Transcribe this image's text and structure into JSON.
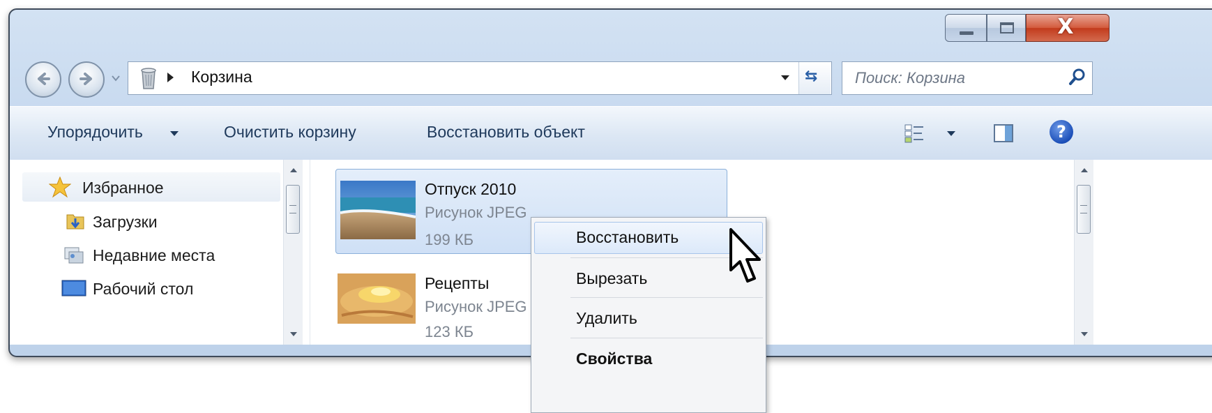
{
  "window": {
    "controls": {
      "close_glyph": "X"
    }
  },
  "address_bar": {
    "location": "Корзина"
  },
  "search": {
    "placeholder": "Поиск: Корзина"
  },
  "toolbar": {
    "organize": "Упорядочить",
    "empty_bin": "Очистить корзину",
    "restore_item": "Восстановить объект",
    "help_glyph": "?"
  },
  "nav_pane": {
    "items": [
      {
        "label": "Избранное",
        "icon": "star-icon"
      },
      {
        "label": "Загрузки",
        "icon": "downloads-folder-icon"
      },
      {
        "label": "Недавние места",
        "icon": "recent-places-icon"
      },
      {
        "label": "Рабочий стол",
        "icon": "desktop-icon"
      }
    ]
  },
  "files": [
    {
      "name": "Отпуск 2010",
      "type": "Рисунок JPEG",
      "size": "199 КБ",
      "selected": true
    },
    {
      "name": "Рецепты",
      "type": "Рисунок JPEG",
      "size": "123 КБ",
      "selected": false
    }
  ],
  "context_menu": {
    "items": [
      "Восстановить",
      "Вырезать",
      "Удалить",
      "Свойства"
    ],
    "highlighted": "Восстановить",
    "bold": "Свойства"
  },
  "colors": {
    "toolbar_text": "#1e395b",
    "selection": "#cfe0f6",
    "close_button": "#c23b1c"
  }
}
